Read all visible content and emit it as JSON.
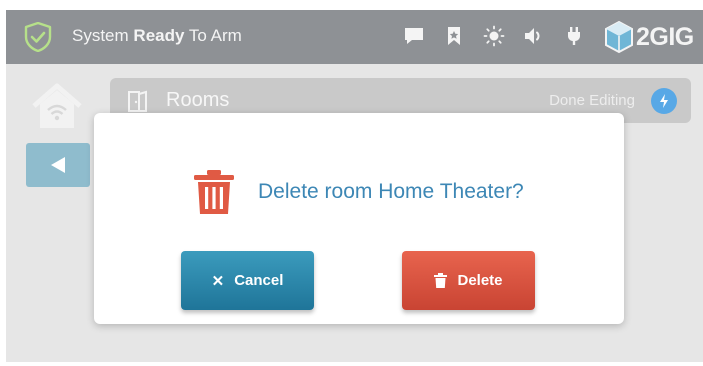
{
  "colors": {
    "status_bar": "#8e9195",
    "backdrop": "#e6e6e6",
    "dialog_text": "#3d87b5",
    "cancel": "#1f7599",
    "delete": "#c94433",
    "trash_icon": "#e05a44"
  },
  "status_bar": {
    "prefix": "System",
    "state": "Ready",
    "suffix": "To Arm",
    "icons": [
      "shield-check-icon",
      "message-icon",
      "bookmark-icon",
      "brightness-icon",
      "volume-icon",
      "plug-icon"
    ],
    "brand": "2GIG"
  },
  "rooms_bar": {
    "title": "Rooms",
    "done_label": "Done Editing"
  },
  "dialog": {
    "message": "Delete room Home Theater?",
    "cancel_label": "Cancel",
    "delete_label": "Delete"
  }
}
